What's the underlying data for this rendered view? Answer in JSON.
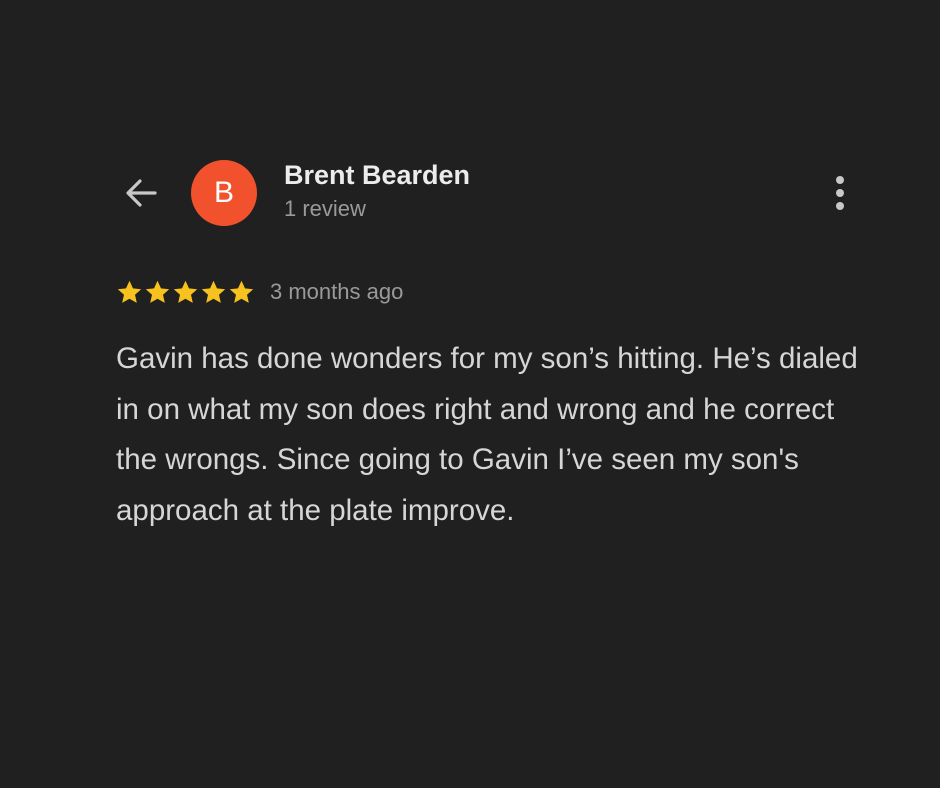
{
  "reviewer": {
    "name": "Brent Bearden",
    "review_count": "1 review",
    "avatar_letter": "B"
  },
  "review": {
    "rating": 5,
    "max_rating": 5,
    "date": "3 months ago",
    "text": "Gavin has done wonders for my son’s hitting. He’s dialed in on what my son does right and wrong and he correct the wrongs. Since going to Gavin I’ve seen my son's approach at the plate improve."
  },
  "icons": {
    "back": "back-arrow-icon",
    "more": "more-vert-icon",
    "star": "star-icon"
  },
  "colors": {
    "background": "#202020",
    "avatar": "#F1522D",
    "star": "#F7C21E",
    "primary_text": "#ECECEC",
    "secondary_text": "#9A9A9A",
    "body_text": "#D6D6D6"
  }
}
